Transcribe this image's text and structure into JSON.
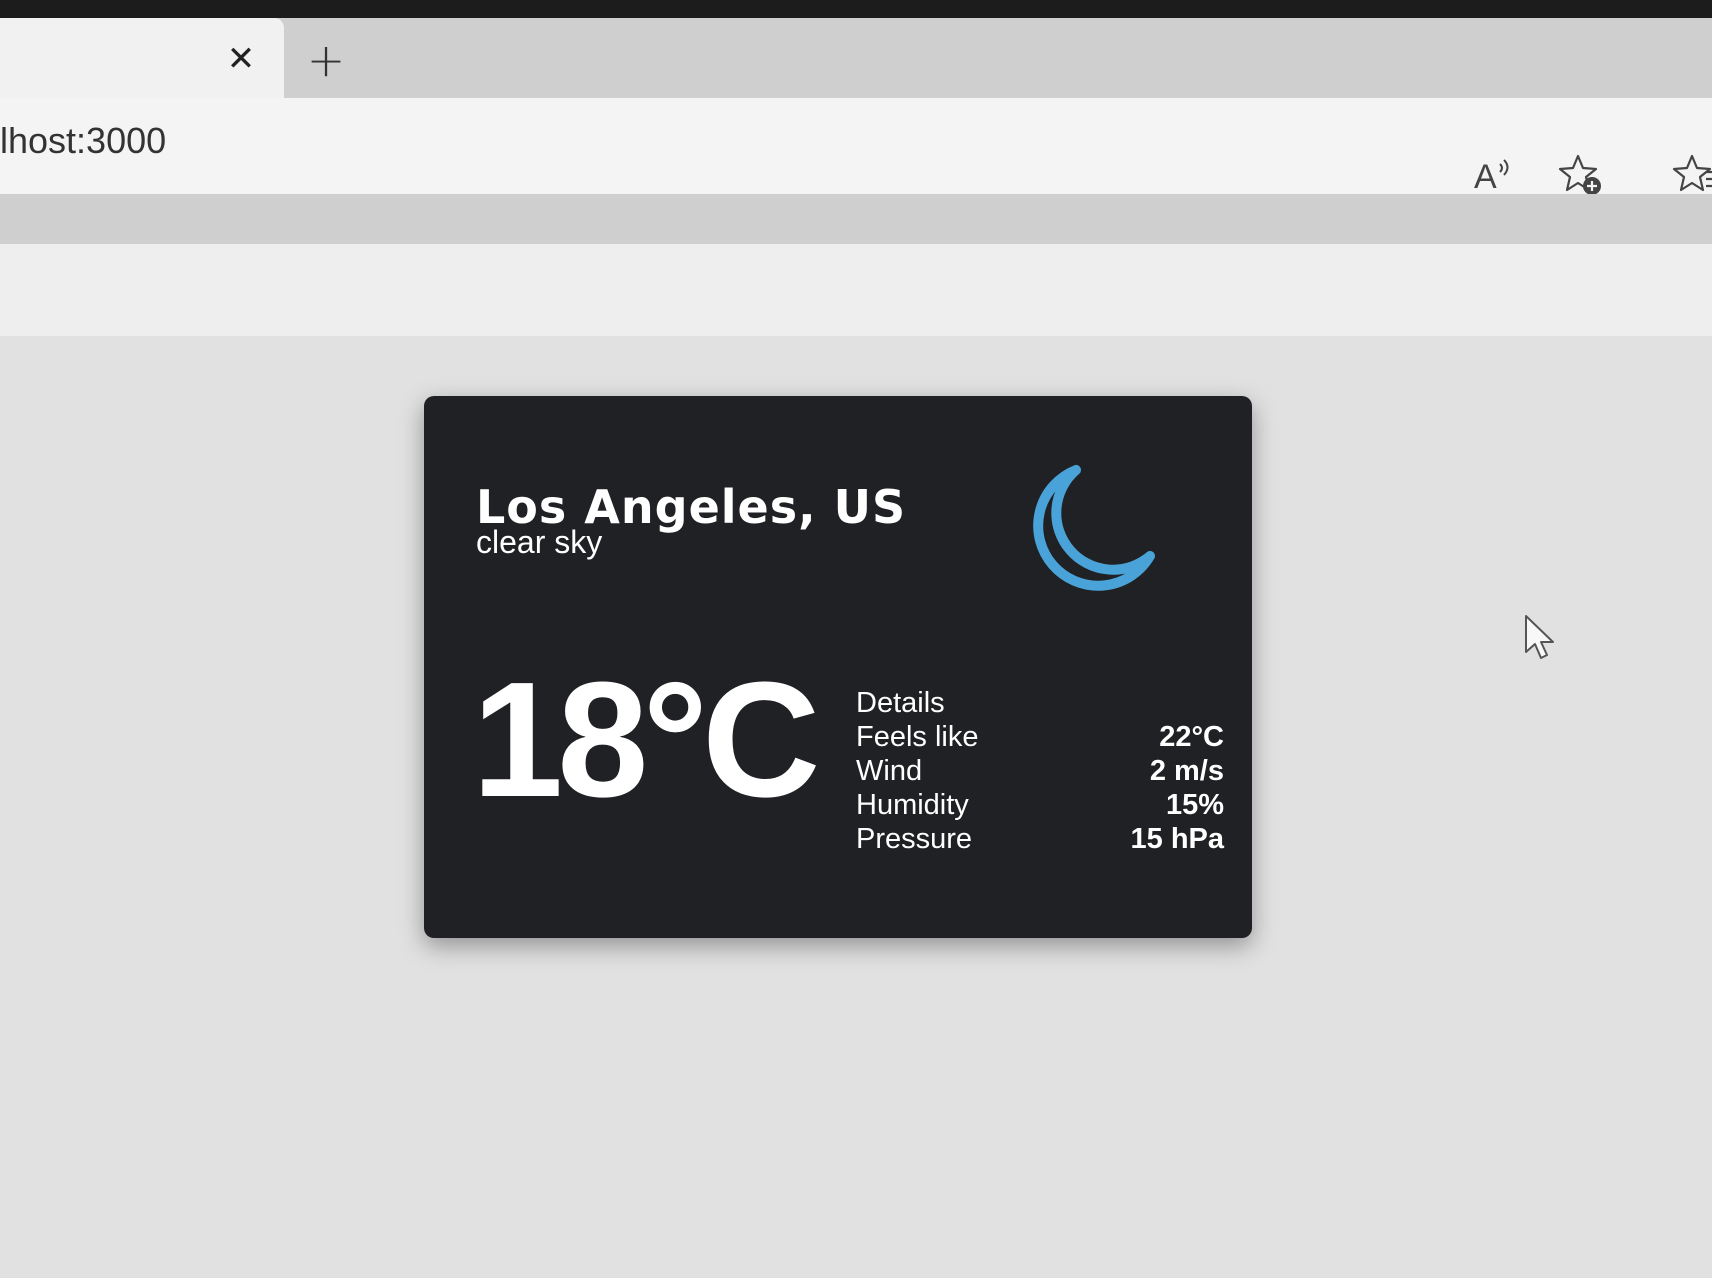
{
  "browser": {
    "tab_close_glyph": "✕",
    "new_tab_glyph": "+",
    "address": "lhost:3000",
    "toolbar_icons": [
      "read-aloud-icon",
      "add-favorite-icon",
      "favorites-icon"
    ]
  },
  "weather": {
    "location": "Los Angeles, US",
    "description": "clear sky",
    "icon": "moon-icon",
    "icon_color": "#4aa3d8",
    "temperature": "18°C",
    "details_title": "Details",
    "details": [
      {
        "label": "Feels like",
        "value": "22°C"
      },
      {
        "label": "Wind",
        "value": "2 m/s"
      },
      {
        "label": "Humidity",
        "value": "15%"
      },
      {
        "label": "Pressure",
        "value": "15 hPa"
      }
    ]
  },
  "colors": {
    "card_bg": "#202124",
    "page_bg": "#e1e1e1"
  }
}
